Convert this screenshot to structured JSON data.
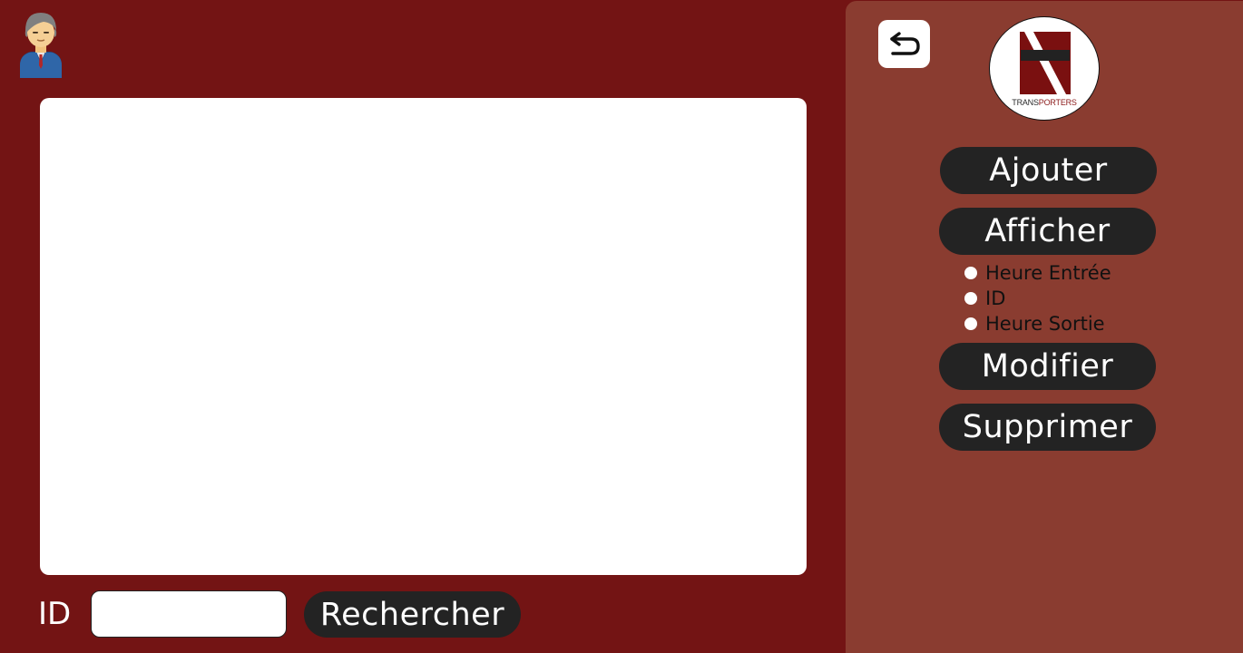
{
  "main": {
    "search": {
      "id_label": "ID",
      "input_value": "",
      "input_placeholder": "",
      "button_label": "Rechercher"
    }
  },
  "sidebar": {
    "logo": {
      "text_prefix": "TRANS",
      "text_accent": "PORTERS"
    },
    "buttons": {
      "ajouter": "Ajouter",
      "afficher": "Afficher",
      "modifier": "Modifier",
      "supprimer": "Supprimer"
    },
    "sort_options": [
      {
        "label": "Heure Entrée"
      },
      {
        "label": "ID"
      },
      {
        "label": "Heure Sortie"
      }
    ]
  },
  "icons": {
    "avatar": "user-avatar-icon",
    "back": "back-arrow-icon"
  },
  "colors": {
    "main_background": "#731414",
    "sidebar_background": "#8a3c30",
    "button_background": "#232323",
    "button_text": "#ffffff",
    "logo_accent": "#8b1a1a"
  }
}
